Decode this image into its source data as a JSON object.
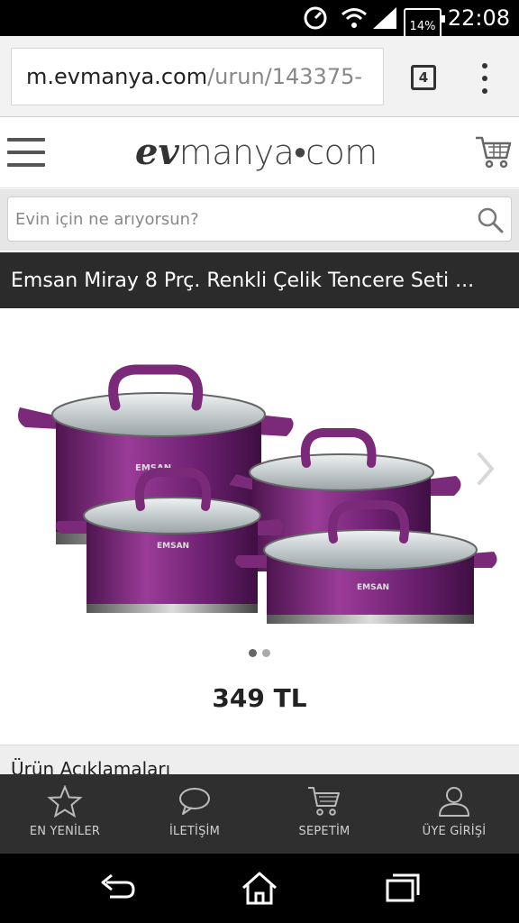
{
  "status_bar": {
    "battery": "14%",
    "time": "22:08"
  },
  "browser": {
    "url_host": "m.evmanya.com",
    "url_path": "/urun/143375-",
    "tab_count": "4"
  },
  "site": {
    "logo_ev": "ev",
    "logo_rest": "manya•com"
  },
  "search": {
    "placeholder": "Evin için ne arıyorsun?"
  },
  "product": {
    "title": "Emsan Miray 8 Prç. Renkli Çelik Tencere Seti ...",
    "price": "349 TL",
    "brand_label": "EMSAN",
    "image_count": 2,
    "active_image": 1,
    "description_header": "Ürün Açıklamaları"
  },
  "bottom_nav": {
    "items": [
      {
        "label": "EN YENİLER",
        "icon": "star-icon"
      },
      {
        "label": "İLETİŞİM",
        "icon": "chat-bubble-icon"
      },
      {
        "label": "SEPETİM",
        "icon": "cart-icon"
      },
      {
        "label": "ÜYE GİRİŞİ",
        "icon": "user-icon"
      }
    ]
  },
  "colors": {
    "pot_purple": "#7a2a78",
    "header_dark": "#2b2b2b",
    "nav_dark": "#2f2f2f"
  }
}
